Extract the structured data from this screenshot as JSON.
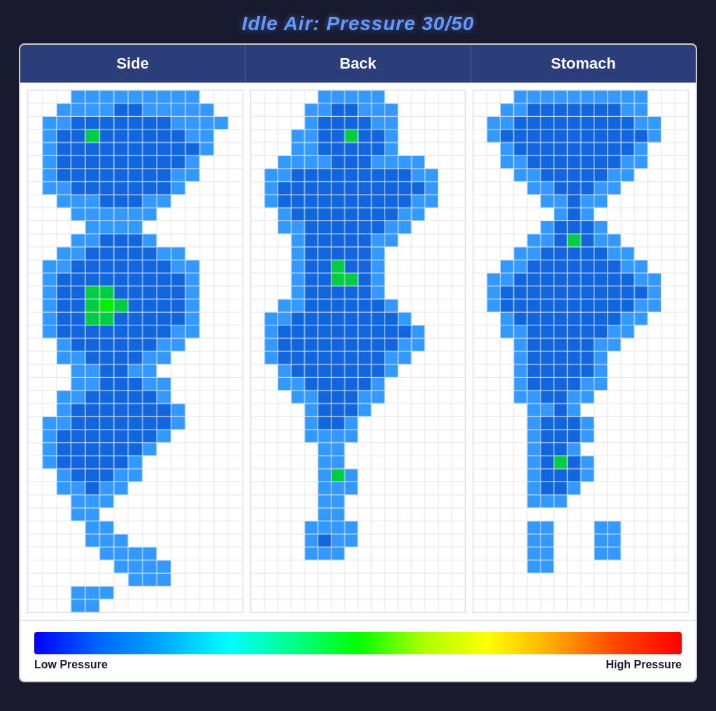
{
  "title": "Idle Air: Pressure 30/50",
  "header": {
    "columns": [
      "Side",
      "Back",
      "Stomach"
    ]
  },
  "legend": {
    "low_label": "Low Pressure",
    "high_label": "High Pressure"
  }
}
